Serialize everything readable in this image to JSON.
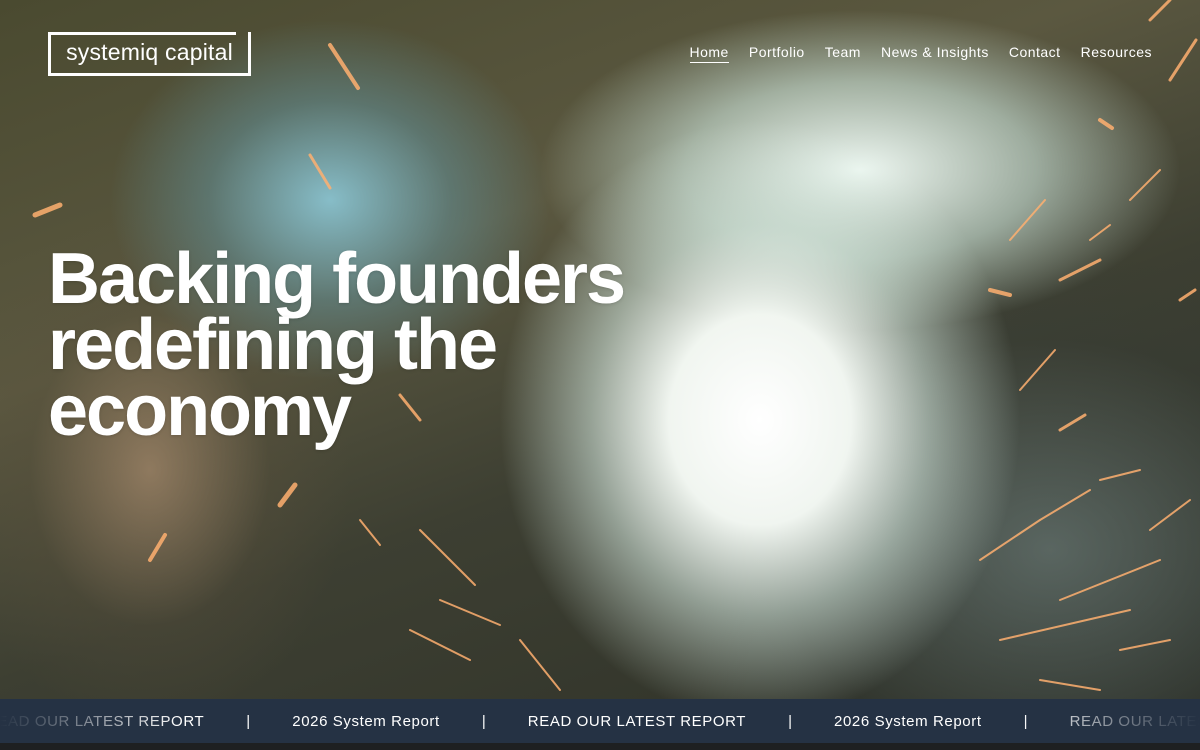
{
  "brand": {
    "logo_text": "systemiq capital"
  },
  "nav": {
    "items": [
      {
        "label": "Home",
        "active": true
      },
      {
        "label": "Portfolio",
        "active": false
      },
      {
        "label": "Team",
        "active": false
      },
      {
        "label": "News & Insights",
        "active": false
      },
      {
        "label": "Contact",
        "active": false
      },
      {
        "label": "Resources",
        "active": false
      }
    ]
  },
  "hero": {
    "headline_lines": [
      "Backing founders",
      "redefining the",
      "economy"
    ]
  },
  "ticker": {
    "items": [
      "READ OUR LATEST REPORT",
      "2026 System Report",
      "READ OUR LATEST REPORT",
      "2026 System Report",
      "READ OUR LATEST REPORT"
    ],
    "separator": "|"
  },
  "colors": {
    "ticker_background": "#253244",
    "text": "#ffffff"
  }
}
